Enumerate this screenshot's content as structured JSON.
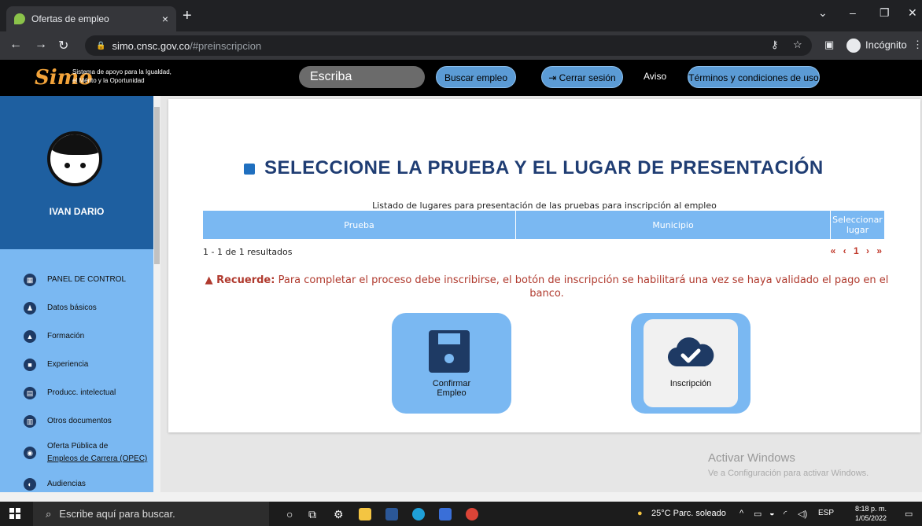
{
  "browser": {
    "tab_title": "Ofertas de empleo",
    "tab_close": "×",
    "new_tab": "+",
    "url_host": "simo.cnsc.gov.co",
    "url_path": "/#preinscripcion",
    "incognito_label": "Incógnito"
  },
  "header": {
    "logo_mark": "Simo",
    "logo_tagline_1": "Sistema de apoyo para la Igualdad,",
    "logo_tagline_2": "el Mérito y la Oportunidad",
    "search_placeholder": "Escriba",
    "buscar_label": "Buscar empleo",
    "cerrar_label": "Cerrar sesión",
    "aviso_label": "Aviso",
    "terminos_label": "Términos y condiciones de uso"
  },
  "sidebar": {
    "user_name": "IVAN DARIO",
    "items": [
      {
        "label": "PANEL DE CONTROL",
        "icon": "dashboard-icon"
      },
      {
        "label": "Datos básicos",
        "icon": "users-icon"
      },
      {
        "label": "Formación",
        "icon": "graduation-icon"
      },
      {
        "label": "Experiencia",
        "icon": "briefcase-icon"
      },
      {
        "label": "Producc. intelectual",
        "icon": "book-icon"
      },
      {
        "label": "Otros documentos",
        "icon": "document-icon"
      },
      {
        "label": "Oferta Pública de",
        "label2": "Empleos de Carrera (OPEC)",
        "icon": "globe-icon"
      },
      {
        "label": "Audiencias",
        "icon": "audience-icon"
      }
    ]
  },
  "main": {
    "title": "SELECCIONE LA PRUEBA Y EL LUGAR DE PRESENTACIÓN",
    "caption": "Listado de lugares para presentación de las pruebas para inscripción al empleo",
    "columns": [
      "Prueba",
      "Municipio",
      "Seleccionar lugar"
    ],
    "results": "1 - 1 de 1 resultados",
    "pager": "« ‹ 1 › »",
    "recuerde_label": "Recuerde:",
    "recuerde_text": "Para completar el proceso debe inscribirse, el botón de inscripción se habilitará una vez se haya validado el pago en el banco.",
    "confirm_label_1": "Confirmar",
    "confirm_label_2": "Empleo",
    "inscripcion_label": "Inscripción"
  },
  "watermark": {
    "line1": "Activar Windows",
    "line2": "Ve a Configuración para activar Windows."
  },
  "taskbar": {
    "search_placeholder": "Escribe aquí para buscar.",
    "weather": "25°C  Parc. soleado",
    "lang": "ESP",
    "time": "8:18 p. m.",
    "date": "1/05/2022"
  }
}
